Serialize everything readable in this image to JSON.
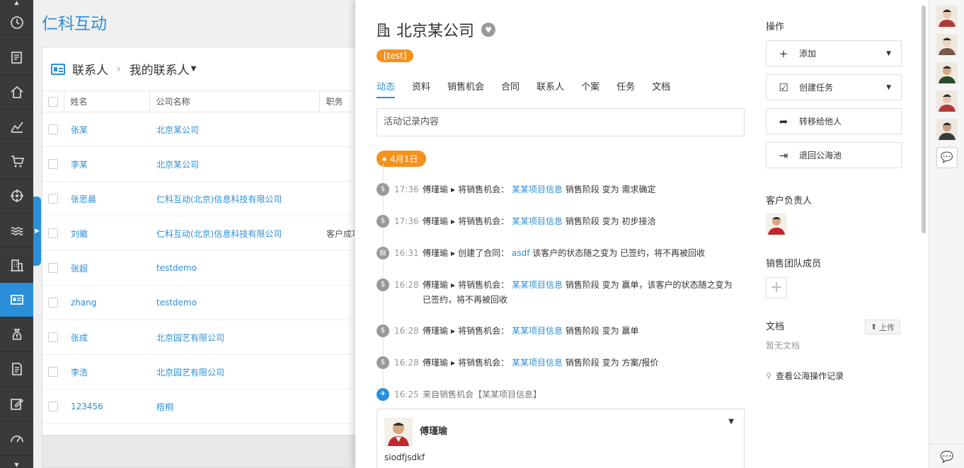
{
  "brand": "仁科互动",
  "colors": {
    "accent": "#2a8fd8",
    "orange": "#f5921e",
    "sidebar": "#3a3a3a"
  },
  "sidebar": {
    "items": [
      {
        "icon": "clock-icon"
      },
      {
        "icon": "form-icon"
      },
      {
        "icon": "home-icon"
      },
      {
        "icon": "leads-icon"
      },
      {
        "icon": "cart-icon"
      },
      {
        "icon": "target-icon"
      },
      {
        "icon": "sea-icon"
      },
      {
        "icon": "building-icon"
      },
      {
        "icon": "contact-card-icon",
        "active": true
      },
      {
        "icon": "money-bag-icon"
      },
      {
        "icon": "document-icon"
      },
      {
        "icon": "edit-icon"
      },
      {
        "icon": "dashboard-icon"
      }
    ]
  },
  "list": {
    "breadcrumb_root": "联系人",
    "breadcrumb_sep": "›",
    "breadcrumb_view": "我的联系人",
    "columns": [
      "姓名",
      "公司名称",
      "职务"
    ],
    "rows": [
      {
        "name": "张某",
        "company": "北京某公司",
        "title": ""
      },
      {
        "name": "李某",
        "company": "北京某公司",
        "title": ""
      },
      {
        "name": "张思晨",
        "company": "仁科互动(北京)信息科技有限公司",
        "title": ""
      },
      {
        "name": "刘徽",
        "company": "仁科互动(北京)信息科技有限公司",
        "title": "客户成功"
      },
      {
        "name": "张超",
        "company": "testdemo",
        "title": ""
      },
      {
        "name": "zhang",
        "company": "testdemo",
        "title": ""
      },
      {
        "name": "张成",
        "company": "北京园艺有限公司",
        "title": ""
      },
      {
        "name": "李浩",
        "company": "北京园艺有限公司",
        "title": ""
      },
      {
        "name": "123456",
        "company": "梧桐",
        "title": ""
      }
    ]
  },
  "detail": {
    "title": "北京某公司",
    "tag": "[test]",
    "tabs": [
      "动态",
      "资料",
      "销售机会",
      "合同",
      "联系人",
      "个案",
      "任务",
      "文档"
    ],
    "activity_placeholder": "活动记录内容",
    "date_badge": "4月1日",
    "timeline": [
      {
        "time": "17:36",
        "user": "傅瑾瑜",
        "action": "将销售机会：",
        "link": "某某项目信息",
        "rest": "销售阶段 变为 需求确定",
        "icon": "money-bag-icon"
      },
      {
        "time": "17:36",
        "user": "傅瑾瑜",
        "action": "将销售机会：",
        "link": "某某项目信息",
        "rest": "销售阶段 变为 初步接洽",
        "icon": "money-bag-icon"
      },
      {
        "time": "16:31",
        "user": "傅瑾瑜",
        "action": "创建了合同：",
        "link": "asdf",
        "rest": "该客户的状态随之变为 已签约，将不再被回收",
        "icon": "contract-icon"
      },
      {
        "time": "16:28",
        "user": "傅瑾瑜",
        "action": "将销售机会：",
        "link": "某某项目信息",
        "rest": "销售阶段 变为 赢单，该客户的状态随之变为",
        "rest2": "已签约，将不再被回收",
        "icon": "money-bag-icon"
      },
      {
        "time": "16:28",
        "user": "傅瑾瑜",
        "action": "将销售机会：",
        "link": "某某项目信息",
        "rest": "销售阶段 变为 赢单",
        "icon": "money-bag-icon"
      },
      {
        "time": "16:28",
        "user": "傅瑾瑜",
        "action": "将销售机会：",
        "link": "某某项目信息",
        "rest": "销售阶段 变为 方案/报价",
        "icon": "money-bag-icon"
      }
    ],
    "note": {
      "time": "16:25",
      "source": "来自销售机会【某某项目信息】",
      "icon": "pin-icon"
    },
    "comment": {
      "user": "傅瑾瑜",
      "text": "siodfjsdkf"
    }
  },
  "ops": {
    "heading": "操作",
    "buttons": [
      {
        "label": "添加",
        "icon": "plus-icon",
        "dropdown": true
      },
      {
        "label": "创建任务",
        "icon": "checkbox-icon",
        "dropdown": true
      },
      {
        "label": "转移给他人",
        "icon": "share-icon",
        "dropdown": false
      },
      {
        "label": "退回公海池",
        "icon": "exit-icon",
        "dropdown": false
      }
    ],
    "owner_heading": "客户负责人",
    "team_heading": "销售团队成员",
    "docs_heading": "文档",
    "upload_label": "上传",
    "no_docs": "暂无文档",
    "public_log": "查看公海操作记录"
  }
}
